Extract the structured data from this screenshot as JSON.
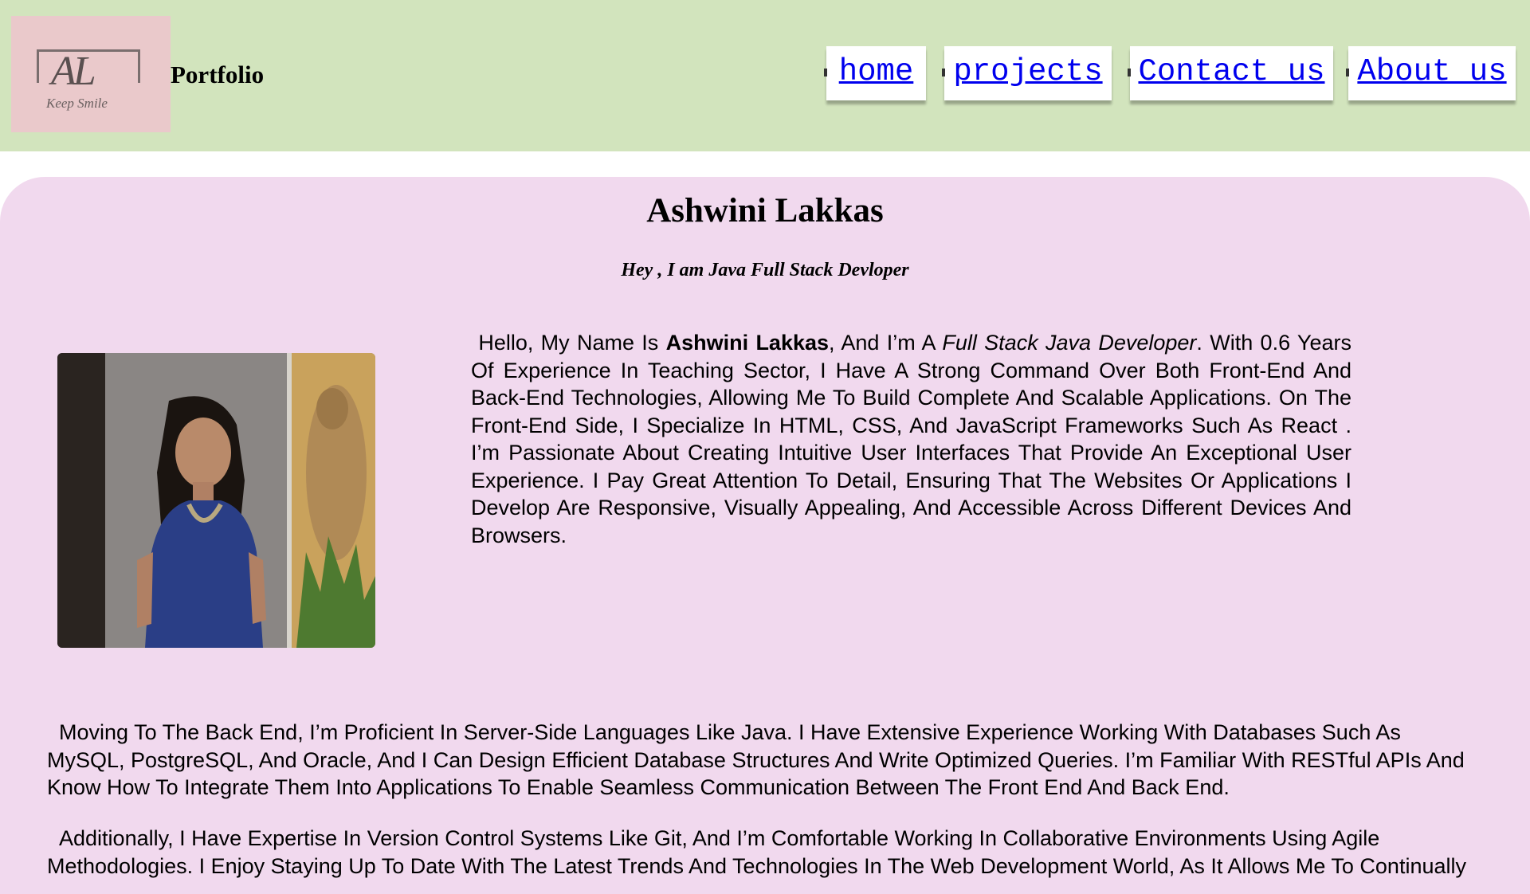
{
  "header": {
    "logo": {
      "initials": "AL",
      "tagline": "Keep Smile"
    },
    "brand": "Portfolio",
    "nav": [
      {
        "label": "home"
      },
      {
        "label": "projects"
      },
      {
        "label": "Contact us"
      },
      {
        "label": "About us"
      }
    ]
  },
  "profile": {
    "name": "Ashwini Lakkas",
    "subtitle": "Hey , I am Java Full Stack Devloper"
  },
  "intro": {
    "lead": "Hello, My Name Is ",
    "name_bold": "Ashwini Lakkas",
    "mid": ", And I’m A ",
    "role_italic": "Full Stack Java Developer",
    "rest": ". With 0.6 Years Of Experience In Teaching Sector, I Have A Strong Command Over Both Front-End And Back-End Technologies, Allowing Me To Build Complete And Scalable Applications. On The Front-End Side, I Specialize In HTML, CSS, And JavaScript Frameworks Such As React . I’m Passionate About Creating Intuitive User Interfaces That Provide An Exceptional User Experience. I Pay Great Attention To Detail, Ensuring That The Websites Or Applications I Develop Are Responsive, Visually Appealing, And Accessible Across Different Devices And Browsers."
  },
  "paragraphs": {
    "backend": "Moving To The Back End, I’m Proficient In Server-Side Languages Like Java. I Have Extensive Experience Working With Databases Such As MySQL, PostgreSQL, And Oracle, And I Can Design Efficient Database Structures And Write Optimized Queries. I’m Familiar With RESTful APIs And Know How To Integrate Them Into Applications To Enable Seamless Communication Between The Front End And Back End.",
    "additional": "Additionally, I Have Expertise In Version Control Systems Like Git, And I’m Comfortable Working In Collaborative Environments Using Agile Methodologies. I Enjoy Staying Up To Date With The Latest Trends And Technologies In The Web Development World, As It Allows Me To Continually"
  },
  "colors": {
    "header_bg": "#d2e4bd",
    "logo_bg": "#eac9cb",
    "main_bg": "#f1d9ee",
    "link": "#0000ee"
  }
}
